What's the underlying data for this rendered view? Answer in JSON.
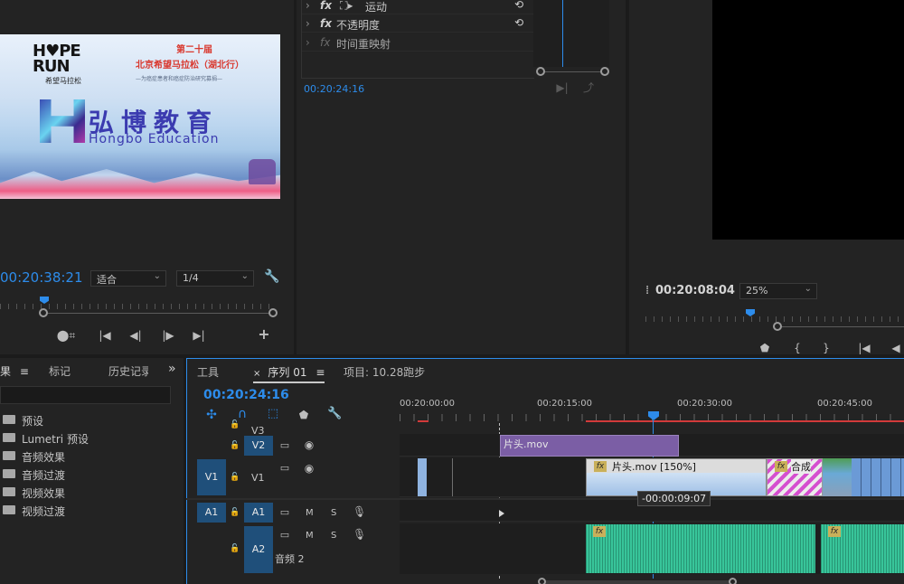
{
  "source_monitor": {
    "timecode": "00:20:38:21",
    "fit_select": "适合",
    "resolution_select": "1/4",
    "thumbnail": {
      "brand_line1": "H♥PE",
      "brand_line2": "RUN",
      "brand_sub": "希望马拉松",
      "event_title_line1": "第二十届",
      "event_title_line2": "北京希望马拉松（湖北行）",
      "event_subtitle": "—为癌症患者和癌症防治研究募捐—",
      "company_cn": "弘博教育",
      "company_en": "Hongbo Education"
    }
  },
  "effect_controls": {
    "rows": [
      {
        "label": "运动",
        "dim": false
      },
      {
        "label": "不透明度",
        "dim": false
      },
      {
        "label": "时间重映射",
        "dim": true
      }
    ],
    "timecode": "00:20:24:16"
  },
  "program_monitor": {
    "timecode": "00:20:08:04",
    "zoom_select": "25%"
  },
  "project_panel": {
    "tabs": [
      "果",
      "标记",
      "历史记录"
    ],
    "items": [
      {
        "label": "预设"
      },
      {
        "label": "Lumetri 预设"
      },
      {
        "label": "音频效果"
      },
      {
        "label": "音频过渡"
      },
      {
        "label": "视频效果"
      },
      {
        "label": "视频过渡"
      }
    ]
  },
  "timeline": {
    "tabs": {
      "tools": "工具",
      "sequence": "序列 01",
      "project": "项目: 10.28跑步"
    },
    "timecode": "00:20:24:16",
    "ruler_labels": [
      "00:20:00:00",
      "00:20:15:00",
      "00:20:30:00",
      "00:20:45:00"
    ],
    "tracks": {
      "v3": "V3",
      "v2": "V2",
      "v1_src": "V1",
      "v1": "V1",
      "a1_src": "A1",
      "a1": "A1",
      "a2": "A2",
      "a2_name": "音频 2",
      "m": "M",
      "s": "S"
    },
    "clips": {
      "v2_clip": "片头.mov",
      "v1_clip": "片头.mov [150%]",
      "v1_clip2": "合成",
      "fx": "fx"
    },
    "tooltip": "-00:00:09:07"
  },
  "colors": {
    "accent": "#2d8ceb",
    "audio_clip": "#38c59a",
    "video_clip_purple": "#7b5ea5",
    "track_blue": "#1f4f7a",
    "work_area_red": "#d23a3a"
  }
}
